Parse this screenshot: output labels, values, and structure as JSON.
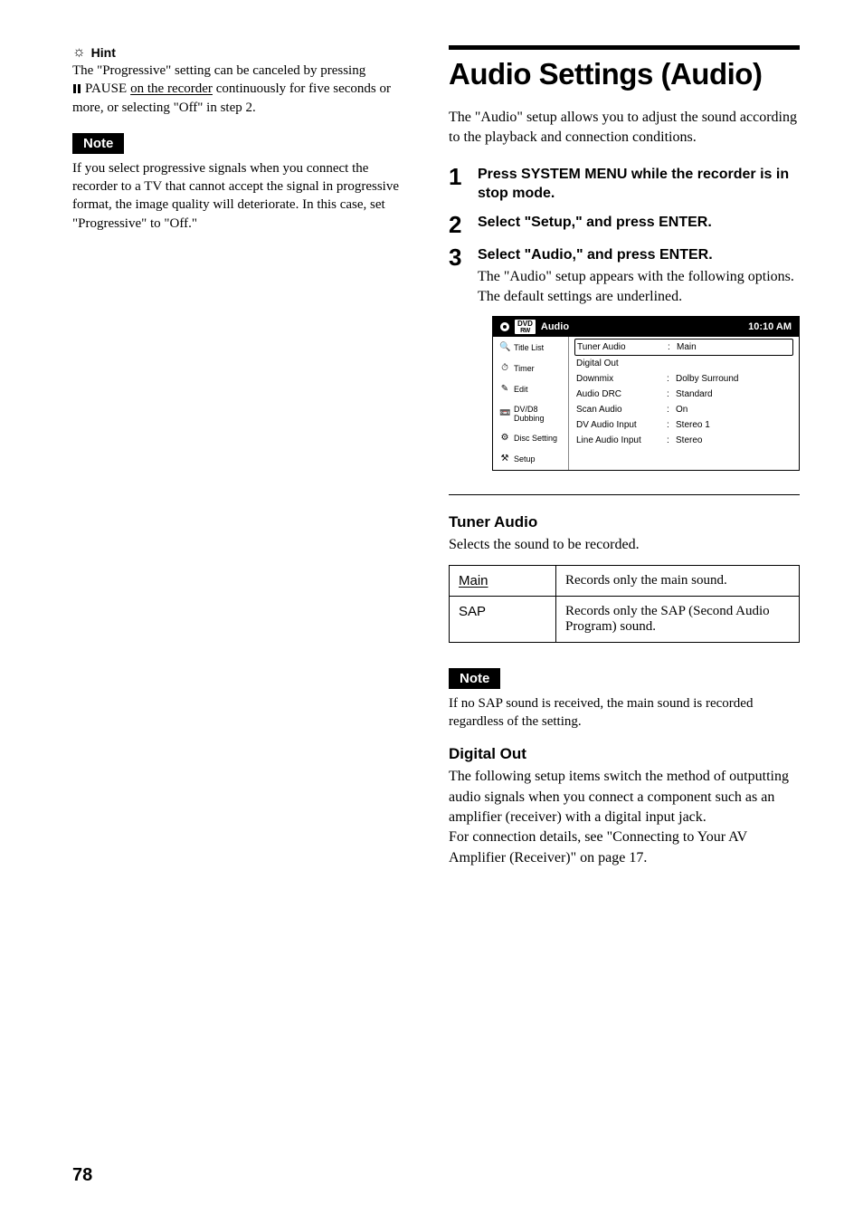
{
  "page_number": "78",
  "left": {
    "hint_label": "Hint",
    "hint_text_a": "The \"Progressive\" setting can be canceled by pressing",
    "hint_text_pause": " PAUSE ",
    "hint_text_b": "on the recorder",
    "hint_text_c": " continuously for five seconds or more, or selecting \"Off\" in step 2.",
    "note_label": "Note",
    "note_body": "If you select progressive signals when you connect the recorder to a TV that cannot accept the signal in progressive format, the image quality will deteriorate. In this case, set \"Progressive\" to \"Off.\""
  },
  "right": {
    "title": "Audio Settings (Audio)",
    "intro": "The \"Audio\" setup allows you to adjust the sound according to the playback and connection conditions.",
    "steps": [
      {
        "num": "1",
        "head": "Press SYSTEM MENU while the recorder is in stop mode."
      },
      {
        "num": "2",
        "head": "Select \"Setup,\" and press ENTER."
      },
      {
        "num": "3",
        "head": "Select \"Audio,\" and press ENTER.",
        "body": "The \"Audio\" setup appears with the following options. The default settings are underlined."
      }
    ],
    "osd": {
      "badge_top": "DVD",
      "badge_bottom": "RW",
      "header_title": "Audio",
      "clock": "10:10 AM",
      "side": [
        "Title List",
        "Timer",
        "Edit",
        "DV/D8 Dubbing",
        "Disc Setting",
        "Setup"
      ],
      "icons": [
        "🔍",
        "⏱",
        "✎",
        "📼",
        "⚙",
        "⚒"
      ],
      "rows": [
        {
          "k": "Tuner Audio",
          "v": "Main",
          "selected": true
        },
        {
          "k": "Digital Out",
          "v": ""
        },
        {
          "k": "Downmix",
          "v": "Dolby Surround"
        },
        {
          "k": "Audio DRC",
          "v": "Standard"
        },
        {
          "k": "Scan Audio",
          "v": "On"
        },
        {
          "k": "DV Audio Input",
          "v": "Stereo 1"
        },
        {
          "k": "Line Audio Input",
          "v": "Stereo"
        }
      ]
    },
    "tuner": {
      "head": "Tuner Audio",
      "body": "Selects the sound to be recorded.",
      "rows": [
        {
          "key": "Main",
          "default": true,
          "desc": "Records only the main sound."
        },
        {
          "key": "SAP",
          "default": false,
          "desc": "Records only the SAP (Second Audio Program) sound."
        }
      ]
    },
    "note2_label": "Note",
    "note2_body": "If no SAP sound is received, the main sound is recorded regardless of the setting.",
    "digital": {
      "head": "Digital Out",
      "body": "The following setup items switch the method of outputting audio signals when you connect a component such as an amplifier (receiver) with a digital input jack.\nFor connection details, see \"Connecting to Your AV Amplifier (Receiver)\" on page 17."
    }
  }
}
